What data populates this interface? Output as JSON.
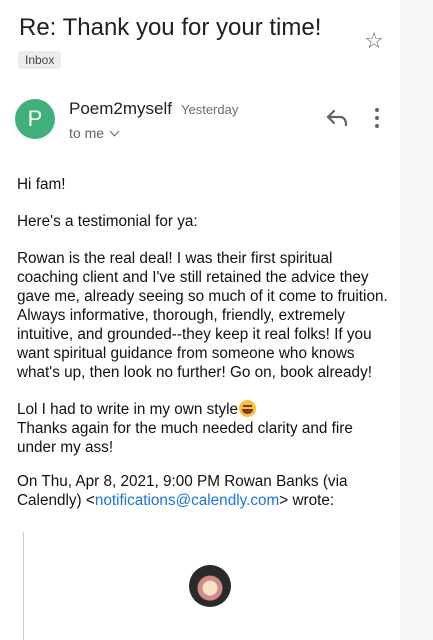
{
  "email": {
    "subject": "Re: Thank you for your time!",
    "label": "Inbox",
    "sender": {
      "name": "Poem2myself",
      "initial": "P",
      "time": "Yesterday",
      "recipient": "to me"
    },
    "body": {
      "greeting": "Hi fam!",
      "intro": "Here's a testimonial for ya:",
      "testimonial": "Rowan is the real deal! I was their first spiritual coaching client and I've still retained the advice they gave me, already seeing so much of it come to fruition. Always informative, thorough, friendly, extremely intuitive, and grounded--they keep it real folks! If you want spiritual guidance from someone who knows what's up, then look no further! Go on, book already!",
      "closing_line1": "Lol I had to write in my own style",
      "closing_line2": "Thanks again for the much needed clarity and fire under my ass!",
      "quote_header_prefix": "On Thu, Apr 8, 2021, 9:00 PM Rowan Banks (via Calendly) <",
      "quote_link": "notifications@calendly.com",
      "quote_header_suffix": "> wrote:"
    }
  },
  "icons": {
    "star": "star-outline-icon",
    "reply": "reply-icon",
    "more": "more-vert-icon",
    "emoji": "grinning-sweat-emoji",
    "quoted_logo": "magnolia-flower-avatar"
  },
  "colors": {
    "avatar": "#3fb07a",
    "link": "#1a73e8"
  }
}
